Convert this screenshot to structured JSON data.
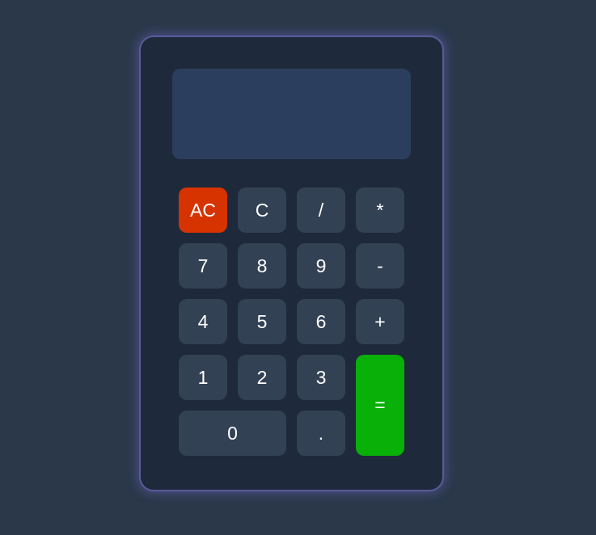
{
  "display": {
    "value": ""
  },
  "keys": {
    "ac": "AC",
    "clear": "C",
    "divide": "/",
    "multiply": "*",
    "seven": "7",
    "eight": "8",
    "nine": "9",
    "subtract": "-",
    "four": "4",
    "five": "5",
    "six": "6",
    "add": "+",
    "one": "1",
    "two": "2",
    "three": "3",
    "equals": "=",
    "zero": "0",
    "dot": "."
  },
  "colors": {
    "background": "#2a384a",
    "body": "#1e293b",
    "display": "#2c3e5e",
    "key": "#334155",
    "ac_key": "#d63300",
    "equals_key": "#08b008",
    "glow": "#7a6ed2"
  }
}
